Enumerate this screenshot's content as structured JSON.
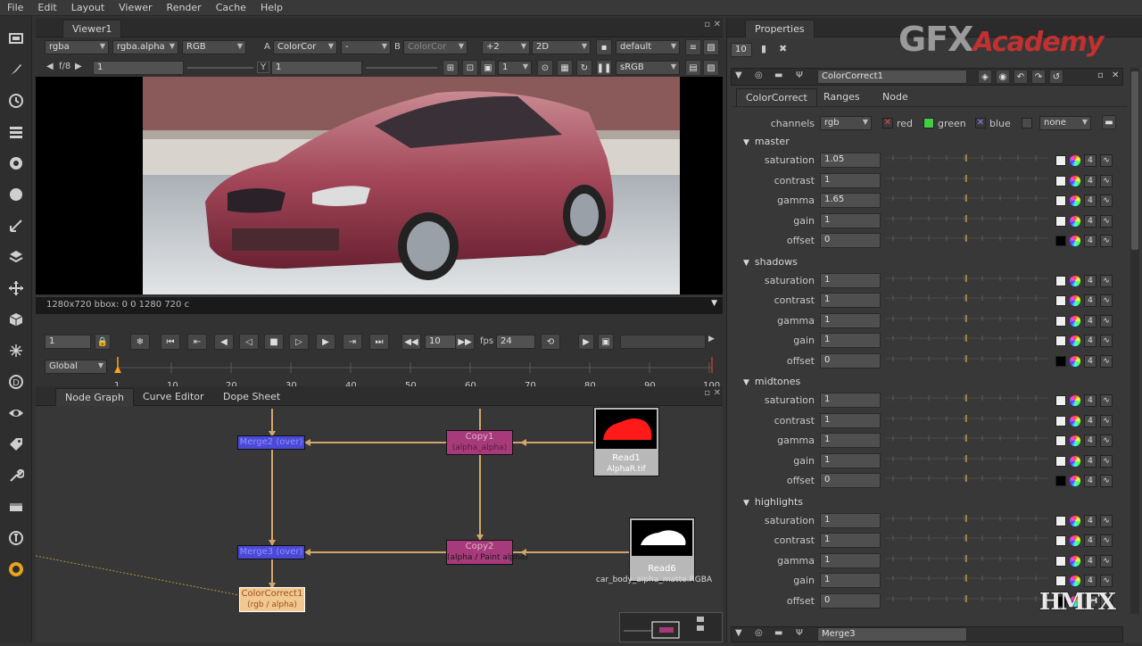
{
  "menubar": {
    "items": [
      "File",
      "Edit",
      "Layout",
      "Viewer",
      "Render",
      "Cache",
      "Help"
    ]
  },
  "viewer": {
    "tab": "Viewer1",
    "channels": "rgba",
    "alpha_channel": "rgba.alpha",
    "display": "RGB",
    "input_a_label": "A",
    "input_a": "ColorCor",
    "input_a_op": "-",
    "input_b_label": "B",
    "input_b": "ColorCor",
    "gain": "+2",
    "mode": "2D",
    "lut": "default",
    "fstop": "f/8",
    "frame_value": "1",
    "y_label": "Y",
    "y_value": "1",
    "proxy": "1",
    "colorspace": "sRGB",
    "status": "1280x720 bbox: 0 0 1280 720 c"
  },
  "playback": {
    "frame": "1",
    "step": "10",
    "fps_label": "fps",
    "fps": "24",
    "scope": "Global",
    "ticks": [
      "1",
      "10",
      "20",
      "30",
      "40",
      "50",
      "60",
      "70",
      "80",
      "90",
      "100"
    ]
  },
  "nodegraph": {
    "tabs": [
      "Node Graph",
      "Curve Editor",
      "Dope Sheet"
    ],
    "nodes": {
      "merge1": "Merge2 (over)",
      "copy1": "Copy1",
      "copy1_sub": "(alpha_alpha)",
      "read1": "Read1",
      "read1_file": "AlphaR.tif",
      "merge2": "Merge3 (over)",
      "copy2": "Copy2",
      "copy2_sub": "(alpha / Paint alpha)",
      "read6": "Read6",
      "read6_file": "car_body_alpha_matte.RGBA",
      "colorcorrect": "ColorCorrect1",
      "colorcorrect_sub": "(rgb / alpha)"
    }
  },
  "properties": {
    "title": "Properties",
    "max_panels": "10",
    "node_name": "ColorCorrect1",
    "tabs": [
      "ColorCorrect",
      "Ranges",
      "Node"
    ],
    "channels_label": "channels",
    "channels_value": "rgb",
    "channel_red": "red",
    "channel_green": "green",
    "channel_blue": "blue",
    "mask_value": "none",
    "sections": [
      {
        "name": "master",
        "params": [
          {
            "label": "saturation",
            "value": "1.05"
          },
          {
            "label": "contrast",
            "value": "1"
          },
          {
            "label": "gamma",
            "value": "1.65"
          },
          {
            "label": "gain",
            "value": "1"
          },
          {
            "label": "offset",
            "value": "0"
          }
        ]
      },
      {
        "name": "shadows",
        "params": [
          {
            "label": "saturation",
            "value": "1"
          },
          {
            "label": "contrast",
            "value": "1"
          },
          {
            "label": "gamma",
            "value": "1"
          },
          {
            "label": "gain",
            "value": "1"
          },
          {
            "label": "offset",
            "value": "0"
          }
        ]
      },
      {
        "name": "midtones",
        "params": [
          {
            "label": "saturation",
            "value": "1"
          },
          {
            "label": "contrast",
            "value": "1"
          },
          {
            "label": "gamma",
            "value": "1"
          },
          {
            "label": "gain",
            "value": "1"
          },
          {
            "label": "offset",
            "value": "0"
          }
        ]
      },
      {
        "name": "highlights",
        "params": [
          {
            "label": "saturation",
            "value": "1"
          },
          {
            "label": "contrast",
            "value": "1"
          },
          {
            "label": "gamma",
            "value": "1"
          },
          {
            "label": "gain",
            "value": "1"
          },
          {
            "label": "offset",
            "value": "0"
          }
        ]
      }
    ],
    "channel_count": "4",
    "next_node": "Merge3"
  },
  "watermark": {
    "brand_main": "GFX",
    "brand_accent": "Academy",
    "corner": "HMFX"
  },
  "colors": {
    "node_merge": "#4a4ad6",
    "node_copy": "#a63a7a",
    "node_colorcorrect": "#f0c890",
    "node_read": "#b8b8b8",
    "wire": "#d2a66a",
    "accent_orange": "#ff9f1a"
  }
}
